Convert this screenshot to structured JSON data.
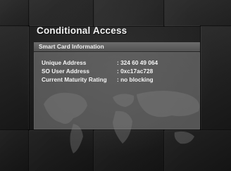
{
  "screen": {
    "title": "Conditional Access",
    "panel": {
      "header": "Smart Card Information",
      "rows": [
        {
          "label": "Unique Address",
          "value": ": 324 60 49 064"
        },
        {
          "label": "SO User Address",
          "value": ": 0xc17ac728"
        },
        {
          "label": "Current Maturity Rating",
          "value": ": no blocking"
        }
      ]
    }
  }
}
